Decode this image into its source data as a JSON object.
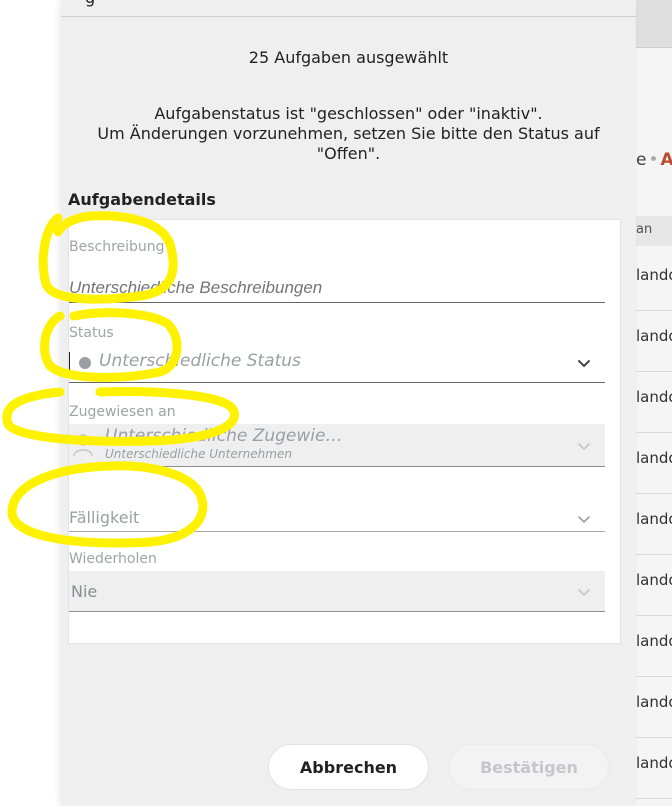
{
  "modal": {
    "title_fragment": "g",
    "selection_count": "25 Aufgaben ausgewählt",
    "notice_line1": "Aufgabenstatus ist \"geschlossen\" oder \"inaktiv\".",
    "notice_line2": "Um Änderungen vorzunehmen, setzen Sie bitte den Status auf",
    "notice_line3": "\"Offen\"."
  },
  "details": {
    "section_title": "Aufgabendetails",
    "description": {
      "label": "Beschreibung",
      "placeholder": "Unterschiedliche Beschreibungen"
    },
    "status": {
      "label": "Status",
      "value": "Unterschiedliche Status",
      "dot_color": "#9b9ea3"
    },
    "assignee": {
      "label": "Zugewiesen an",
      "name": "Unterschiedliche Zugewie…",
      "company": "Unterschiedliche Unternehmen"
    },
    "due": {
      "label": "Fälligkeit"
    },
    "repeat": {
      "label": "Wiederholen",
      "value": "Nie"
    }
  },
  "buttons": {
    "cancel": "Abbrechen",
    "confirm": "Bestätigen"
  },
  "background": {
    "breadcrumb_left": "e",
    "breadcrumb_right": "A",
    "column_header": "an",
    "row_text": [
      "lando",
      "lando",
      "lando",
      "lando",
      "lando",
      "lando",
      "lando",
      "lando",
      "lando"
    ]
  },
  "colors": {
    "accent": "#c0502e",
    "marker": "#fff200"
  }
}
